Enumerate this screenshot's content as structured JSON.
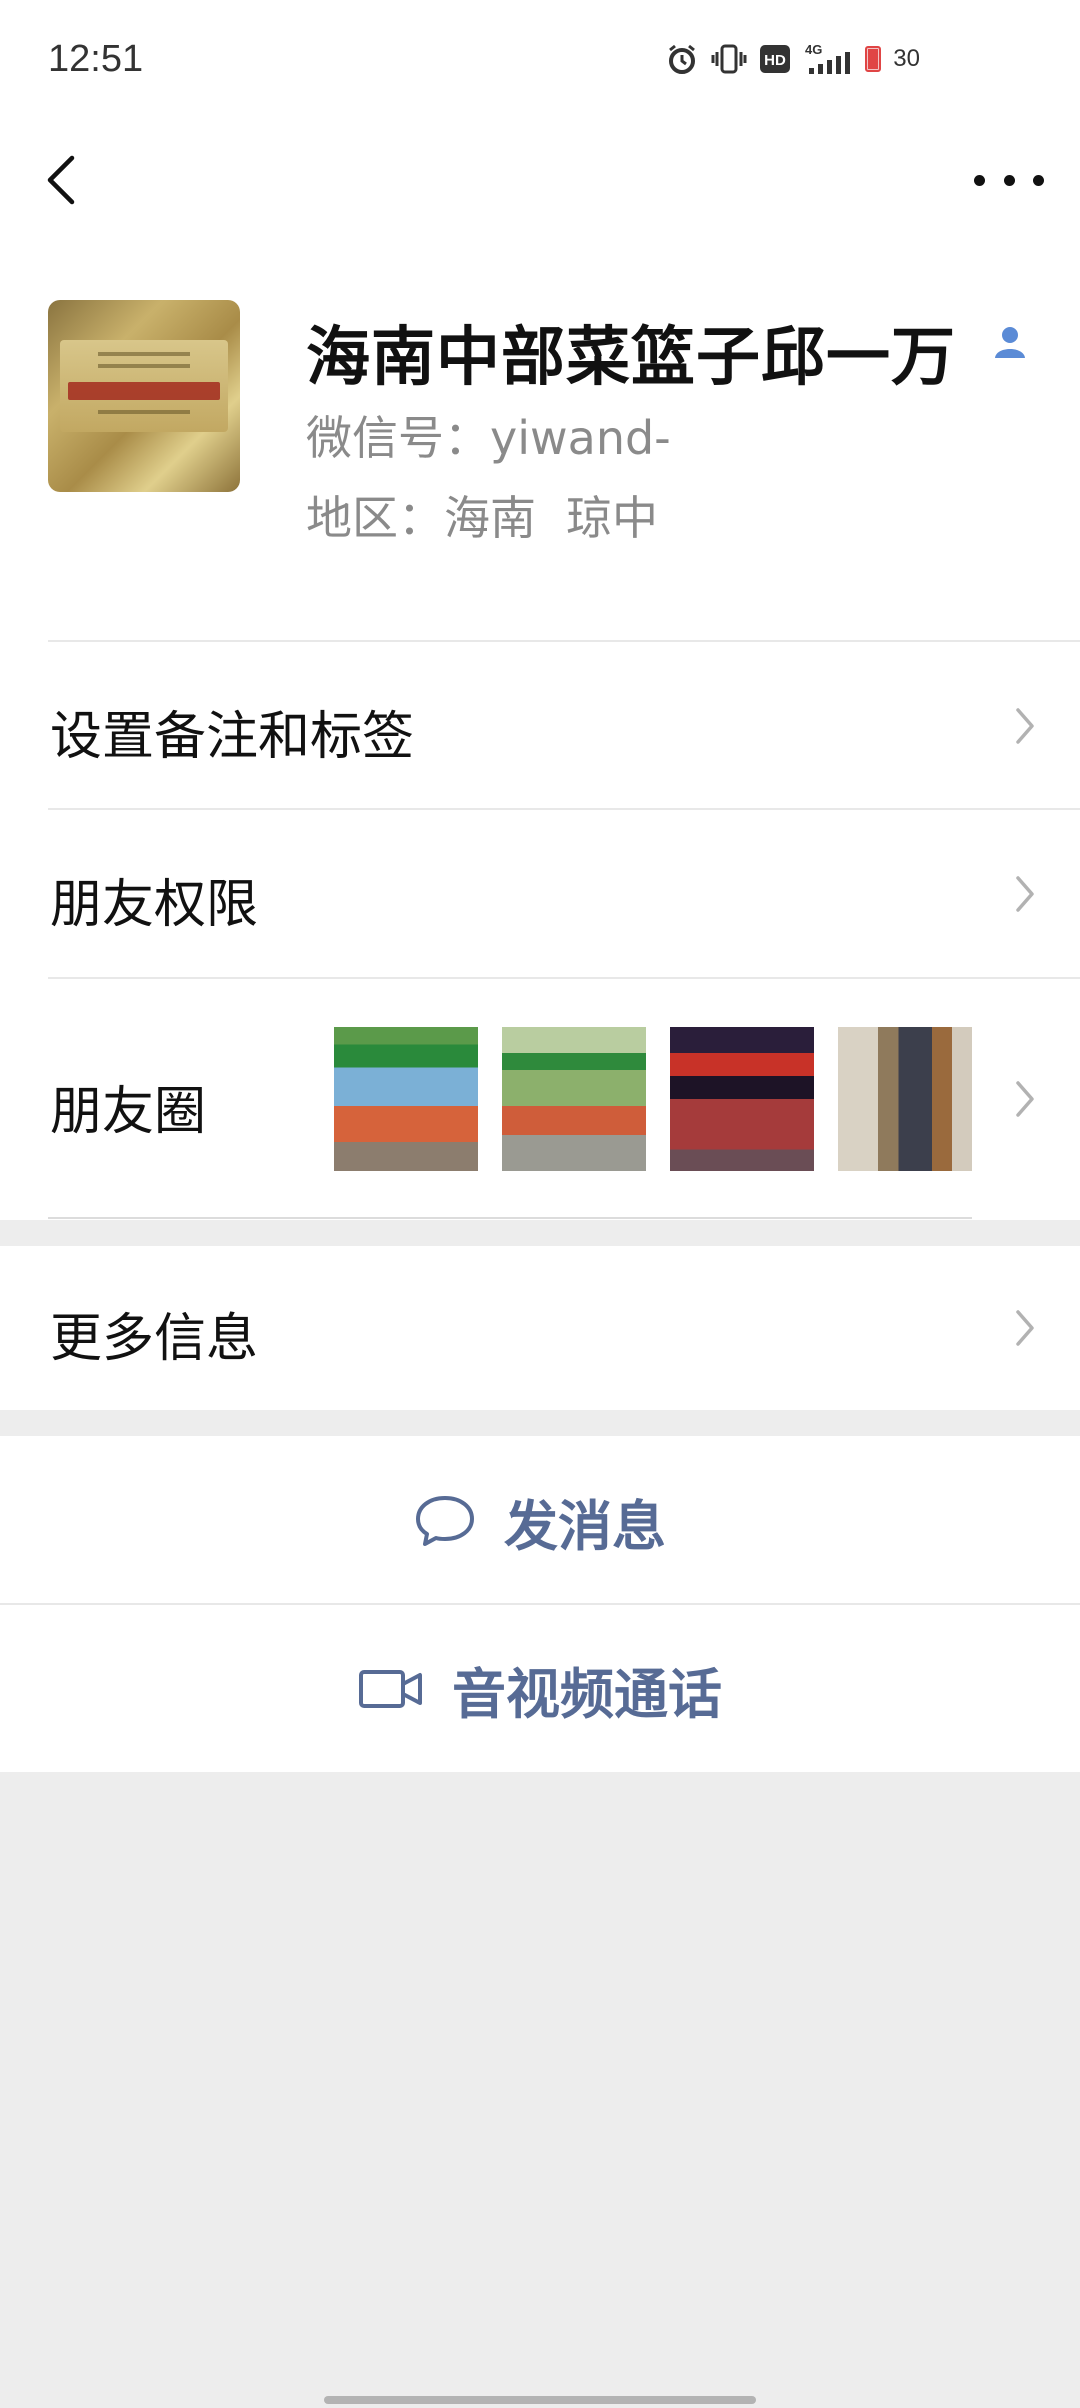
{
  "status_bar": {
    "time": "12:51",
    "network": "4G",
    "battery": "30",
    "icons": [
      "alarm-icon",
      "vibrate-icon",
      "hd-icon",
      "signal-icon",
      "battery-icon"
    ]
  },
  "nav": {
    "back_icon": "chevron-left-icon",
    "more_icon": "more-dots-icon"
  },
  "profile": {
    "name": "海南中部菜篮子邱一万",
    "wechat_id": "微信号：yiwand-",
    "region_label": "地区：",
    "region_province": "海南",
    "region_city": "琼中",
    "badge_icon": "person-icon"
  },
  "rows": {
    "remark_label": "设置备注和标签",
    "permissions_label": "朋友权限",
    "moments_label": "朋友圈",
    "more_info_label": "更多信息"
  },
  "actions": {
    "message_label": "发消息",
    "video_call_label": "音视频通话"
  },
  "colors": {
    "accent": "#576b95",
    "background": "#ededed",
    "card": "#ffffff"
  }
}
